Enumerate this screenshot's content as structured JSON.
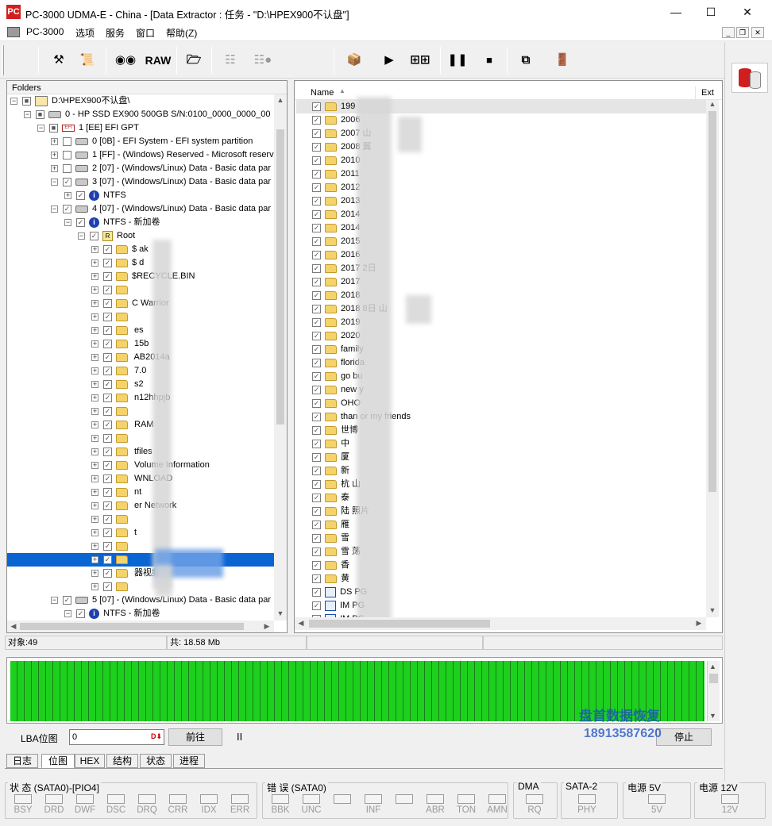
{
  "window": {
    "title": "PC-3000 UDMA-E - China - [Data Extractor : 任务 - \"D:\\HPEX900不认盘\"]",
    "logo": "PC"
  },
  "menu": [
    "PC-3000",
    "选项",
    "服务",
    "窗口",
    "帮助(Z)"
  ],
  "toolbar": {
    "raw_label": "RAW"
  },
  "folders": {
    "header": "Folders",
    "rows": [
      {
        "level": 0,
        "exp": "−",
        "chk": "■",
        "icon": "task",
        "label": "D:\\HPEX900不认盘\\"
      },
      {
        "level": 1,
        "exp": "−",
        "chk": "■",
        "icon": "drive",
        "label": "0 - HP SSD EX900 500GB  S/N:0100_0000_0000_00"
      },
      {
        "level": 2,
        "exp": "−",
        "chk": "■",
        "icon": "efi",
        "label": "1 [EE] EFI GPT"
      },
      {
        "level": 3,
        "exp": "+",
        "chk": "",
        "icon": "drive",
        "label": "0 [0B] - EFI System - EFI system partition"
      },
      {
        "level": 3,
        "exp": "+",
        "chk": "",
        "icon": "drive",
        "label": "1 [FF] - (Windows) Reserved - Microsoft reserv"
      },
      {
        "level": 3,
        "exp": "+",
        "chk": "",
        "icon": "drive",
        "label": "2 [07] - (Windows/Linux) Data - Basic data par"
      },
      {
        "level": 3,
        "exp": "−",
        "chk": "✓",
        "icon": "drive",
        "label": "3 [07] - (Windows/Linux) Data - Basic data par"
      },
      {
        "level": 4,
        "exp": "+",
        "chk": "✓",
        "icon": "info",
        "label": "NTFS"
      },
      {
        "level": 3,
        "exp": "−",
        "chk": "✓",
        "icon": "drive",
        "label": "4 [07] - (Windows/Linux) Data - Basic data par"
      },
      {
        "level": 4,
        "exp": "−",
        "chk": "✓",
        "icon": "info",
        "label": "NTFS - 新加卷"
      },
      {
        "level": 5,
        "exp": "−",
        "chk": "✓",
        "icon": "root",
        "label": "Root"
      },
      {
        "level": 6,
        "exp": "+",
        "chk": "✓",
        "icon": "folder",
        "label": "$           ak"
      },
      {
        "level": 6,
        "exp": "+",
        "chk": "✓",
        "icon": "folder",
        "label": "$           d"
      },
      {
        "level": 6,
        "exp": "+",
        "chk": "✓",
        "icon": "folder",
        "label": "$RECYCLE.BIN"
      },
      {
        "level": 6,
        "exp": "+",
        "chk": "✓",
        "icon": "folder",
        "label": ""
      },
      {
        "level": 6,
        "exp": "+",
        "chk": "✓",
        "icon": "folder",
        "label": "C      Warrior"
      },
      {
        "level": 6,
        "exp": "+",
        "chk": "✓",
        "icon": "folder",
        "label": ""
      },
      {
        "level": 6,
        "exp": "+",
        "chk": "✓",
        "icon": "folder",
        "label": "        es"
      },
      {
        "level": 6,
        "exp": "+",
        "chk": "✓",
        "icon": "folder",
        "label": "          15b"
      },
      {
        "level": 6,
        "exp": "+",
        "chk": "✓",
        "icon": "folder",
        "label": "         AB2014a"
      },
      {
        "level": 6,
        "exp": "+",
        "chk": "✓",
        "icon": "folder",
        "label": "         7.0"
      },
      {
        "level": 6,
        "exp": "+",
        "chk": "✓",
        "icon": "folder",
        "label": "      s2"
      },
      {
        "level": 6,
        "exp": "+",
        "chk": "✓",
        "icon": "folder",
        "label": "        n12hhpjb"
      },
      {
        "level": 6,
        "exp": "+",
        "chk": "✓",
        "icon": "folder",
        "label": ""
      },
      {
        "level": 6,
        "exp": "+",
        "chk": "✓",
        "icon": "folder",
        "label": "         RAM"
      },
      {
        "level": 6,
        "exp": "+",
        "chk": "✓",
        "icon": "folder",
        "label": ""
      },
      {
        "level": 6,
        "exp": "+",
        "chk": "✓",
        "icon": "folder",
        "label": "          tfiles"
      },
      {
        "level": 6,
        "exp": "+",
        "chk": "✓",
        "icon": "folder",
        "label": "          Volume Information"
      },
      {
        "level": 6,
        "exp": "+",
        "chk": "✓",
        "icon": "folder",
        "label": "         WNLOAD"
      },
      {
        "level": 6,
        "exp": "+",
        "chk": "✓",
        "icon": "folder",
        "label": "          nt"
      },
      {
        "level": 6,
        "exp": "+",
        "chk": "✓",
        "icon": "folder",
        "label": "          er Network"
      },
      {
        "level": 6,
        "exp": "+",
        "chk": "✓",
        "icon": "folder",
        "label": ""
      },
      {
        "level": 6,
        "exp": "+",
        "chk": "✓",
        "icon": "folder",
        "label": "          t"
      },
      {
        "level": 6,
        "exp": "+",
        "chk": "✓",
        "icon": "folder",
        "label": ""
      },
      {
        "level": 6,
        "exp": "+",
        "chk": "✓",
        "icon": "folder",
        "label": "",
        "selected": true
      },
      {
        "level": 6,
        "exp": "+",
        "chk": "✓",
        "icon": "folder",
        "label": "                 器视频"
      },
      {
        "level": 6,
        "exp": "+",
        "chk": "✓",
        "icon": "folder",
        "label": ""
      },
      {
        "level": 3,
        "exp": "−",
        "chk": "✓",
        "icon": "drive",
        "label": "5 [07] - (Windows/Linux) Data - Basic data par"
      },
      {
        "level": 4,
        "exp": "−",
        "chk": "✓",
        "icon": "info",
        "label": "NTFS - 新加卷"
      }
    ]
  },
  "file_list": {
    "columns": [
      "Name",
      "Ext"
    ],
    "rows": [
      {
        "icon": "folder",
        "label": "199"
      },
      {
        "icon": "folder",
        "label": "2006"
      },
      {
        "icon": "folder",
        "label": "2007            山"
      },
      {
        "icon": "folder",
        "label": "2008            翼"
      },
      {
        "icon": "folder",
        "label": "2010"
      },
      {
        "icon": "folder",
        "label": "2011"
      },
      {
        "icon": "folder",
        "label": "2012"
      },
      {
        "icon": "folder",
        "label": "2013"
      },
      {
        "icon": "folder",
        "label": "2014"
      },
      {
        "icon": "folder",
        "label": "2014"
      },
      {
        "icon": "folder",
        "label": "2015"
      },
      {
        "icon": "folder",
        "label": "2016"
      },
      {
        "icon": "folder",
        "label": "2017           2日"
      },
      {
        "icon": "folder",
        "label": "2017"
      },
      {
        "icon": "folder",
        "label": "2018"
      },
      {
        "icon": "folder",
        "label": "2018           8日        山"
      },
      {
        "icon": "folder",
        "label": "2019"
      },
      {
        "icon": "folder",
        "label": "2020"
      },
      {
        "icon": "folder",
        "label": "family"
      },
      {
        "icon": "folder",
        "label": "florida"
      },
      {
        "icon": "folder",
        "label": "go bu"
      },
      {
        "icon": "folder",
        "label": "new y"
      },
      {
        "icon": "folder",
        "label": "OHO"
      },
      {
        "icon": "folder",
        "label": "than           or my friends"
      },
      {
        "icon": "folder",
        "label": "世博"
      },
      {
        "icon": "folder",
        "label": "中"
      },
      {
        "icon": "folder",
        "label": "厦"
      },
      {
        "icon": "folder",
        "label": "新"
      },
      {
        "icon": "folder",
        "label": "杭              山"
      },
      {
        "icon": "folder",
        "label": "泰"
      },
      {
        "icon": "folder",
        "label": "陆              照片"
      },
      {
        "icon": "folder",
        "label": "雁"
      },
      {
        "icon": "folder",
        "label": "雪"
      },
      {
        "icon": "folder",
        "label": "雪              荡"
      },
      {
        "icon": "folder",
        "label": "香"
      },
      {
        "icon": "folder",
        "label": "黄"
      },
      {
        "icon": "image",
        "label": "DS             PG"
      },
      {
        "icon": "image",
        "label": "IM             PG"
      },
      {
        "icon": "image",
        "label": "IM             PG"
      }
    ]
  },
  "status": {
    "objects": "对象:49",
    "total": "共:  18.58 Mb"
  },
  "controls": {
    "lba_label": "LBA位图",
    "lba_value": "0",
    "goto_label": "前往",
    "pause_label": "II",
    "stop_label": "停止"
  },
  "tabs": [
    "日志",
    "位图",
    "HEX",
    "结构",
    "状态",
    "进程"
  ],
  "indicators": {
    "status": {
      "title": "状 态 (SATA0)-[PIO4]",
      "leds": [
        "BSY",
        "DRD",
        "DWF",
        "DSC",
        "DRQ",
        "CRR",
        "IDX",
        "ERR"
      ]
    },
    "error": {
      "title": "错 误 (SATA0)",
      "leds": [
        "BBK",
        "UNC",
        "",
        "INF",
        "",
        "ABR",
        "TON",
        "AMN"
      ]
    },
    "dma": {
      "title": "DMA",
      "leds": [
        "RQ"
      ]
    },
    "sata": {
      "title": "SATA-2",
      "leds": [
        "PHY"
      ]
    },
    "pw5": {
      "title": "电源 5V",
      "leds": [
        "5V"
      ]
    },
    "pw12": {
      "title": "电源 12V",
      "leds": [
        "12V"
      ]
    }
  },
  "watermark": {
    "line1": "盘首数据恢复",
    "line2": "18913587620"
  },
  "colors": {
    "selection": "#0a64d2",
    "map_block": "#1ed01e",
    "logo": "#d21f1f"
  }
}
